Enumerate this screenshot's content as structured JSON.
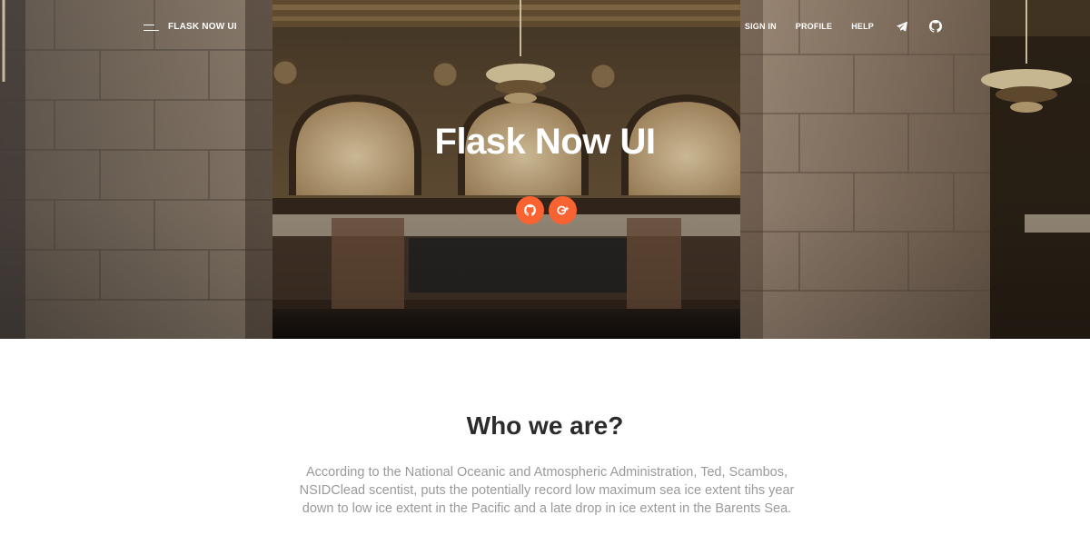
{
  "navbar": {
    "brand": "FLASK NOW UI",
    "links": [
      "SIGN IN",
      "PROFILE",
      "HELP"
    ],
    "icons": [
      "telegram-icon",
      "github-icon"
    ]
  },
  "hero": {
    "title": "Flask Now UI",
    "buttons": [
      "github-icon",
      "google-plus-icon"
    ]
  },
  "about": {
    "title": "Who we are?",
    "text": "According to the National Oceanic and Atmospheric Administration, Ted, Scambos, NSIDClead scentist, puts the potentially record low maximum sea ice extent tihs year down to low ice extent in the Pacific and a late drop in ice extent in the Barents Sea."
  },
  "colors": {
    "accent": "#f96332",
    "heading": "#2c2c2c",
    "body_text": "#9a9a9a"
  }
}
